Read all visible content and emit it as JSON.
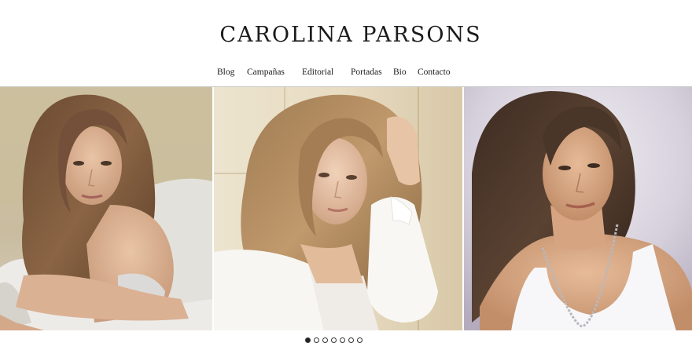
{
  "site": {
    "title": "CAROLINA PARSONS"
  },
  "nav": {
    "items": [
      {
        "label": "Blog"
      },
      {
        "label": "Campañas"
      },
      {
        "label": "Editorial"
      },
      {
        "label": "Portadas"
      },
      {
        "label": "Bio"
      },
      {
        "label": "Contacto"
      }
    ]
  },
  "gallery": {
    "photos": [
      {
        "name": "photo-woman-lying-on-bed"
      },
      {
        "name": "photo-woman-white-blouse"
      },
      {
        "name": "photo-woman-white-tank-top"
      }
    ],
    "slide_count": 7,
    "active_slide": 1
  },
  "colors": {
    "text": "#1b1b1b",
    "divider": "#c8c8c8",
    "dot_active": "#222222"
  }
}
